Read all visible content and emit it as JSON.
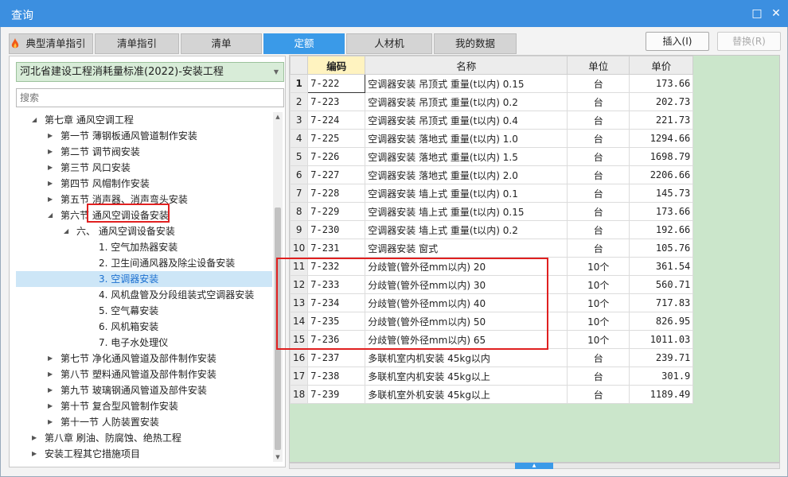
{
  "window": {
    "title": "查询",
    "minimize_glyph": "□",
    "close_glyph": "✕"
  },
  "tabs": [
    {
      "label": "典型清单指引",
      "active": false,
      "icon": "fire-icon"
    },
    {
      "label": "清单指引",
      "active": false
    },
    {
      "label": "清单",
      "active": false
    },
    {
      "label": "定额",
      "active": true
    },
    {
      "label": "人材机",
      "active": false
    },
    {
      "label": "我的数据",
      "active": false
    }
  ],
  "actions": {
    "insert_label": "插入(I)",
    "replace_label": "替换(R)"
  },
  "left": {
    "select_value": "河北省建设工程消耗量标准(2022)-安装工程",
    "search_placeholder": "搜索",
    "tree": [
      {
        "label": "第七章 通风空调工程",
        "level": 0,
        "expanded": true
      },
      {
        "label": "第一节 薄钢板通风管道制作安装",
        "level": 1,
        "expanded": false
      },
      {
        "label": "第二节 调节阀安装",
        "level": 1,
        "expanded": false
      },
      {
        "label": "第三节 风口安装",
        "level": 1,
        "expanded": false
      },
      {
        "label": "第四节 风帽制作安装",
        "level": 1,
        "expanded": false
      },
      {
        "label": "第五节 消声器、消声弯头安装",
        "level": 1,
        "expanded": false
      },
      {
        "label": "第六节 通风空调设备安装",
        "level": 1,
        "expanded": true
      },
      {
        "label": "六、 通风空调设备安装",
        "level": 2,
        "expanded": true
      },
      {
        "label": "1. 空气加热器安装",
        "level": 3
      },
      {
        "label": "2. 卫生间通风器及除尘设备安装",
        "level": 3
      },
      {
        "label": "3. 空调器安装",
        "level": 3,
        "selected": true
      },
      {
        "label": "4. 风机盘管及分段组装式空调器安装",
        "level": 3
      },
      {
        "label": "5. 空气幕安装",
        "level": 3
      },
      {
        "label": "6. 风机箱安装",
        "level": 3
      },
      {
        "label": "7. 电子水处理仪",
        "level": 3
      },
      {
        "label": "第七节 净化通风管道及部件制作安装",
        "level": 1,
        "expanded": false
      },
      {
        "label": "第八节 塑料通风管道及部件制作安装",
        "level": 1,
        "expanded": false
      },
      {
        "label": "第九节 玻璃钢通风管道及部件安装",
        "level": 1,
        "expanded": false
      },
      {
        "label": "第十节 复合型风管制作安装",
        "level": 1,
        "expanded": false
      },
      {
        "label": "第十一节 人防装置安装",
        "level": 1,
        "expanded": false
      },
      {
        "label": "第八章 刷油、防腐蚀、绝热工程",
        "level": 0,
        "expanded": false
      },
      {
        "label": "安装工程其它措施项目",
        "level": 0,
        "expanded": false
      }
    ]
  },
  "grid": {
    "columns": [
      "",
      "编码",
      "名称",
      "单位",
      "单价"
    ],
    "rows": [
      [
        "1",
        "7-222",
        "空调器安装 吊顶式 重量(t以内) 0.15",
        "台",
        "173.66"
      ],
      [
        "2",
        "7-223",
        "空调器安装 吊顶式 重量(t以内) 0.2",
        "台",
        "202.73"
      ],
      [
        "3",
        "7-224",
        "空调器安装 吊顶式 重量(t以内) 0.4",
        "台",
        "221.73"
      ],
      [
        "4",
        "7-225",
        "空调器安装 落地式 重量(t以内) 1.0",
        "台",
        "1294.66"
      ],
      [
        "5",
        "7-226",
        "空调器安装 落地式 重量(t以内) 1.5",
        "台",
        "1698.79"
      ],
      [
        "6",
        "7-227",
        "空调器安装 落地式 重量(t以内) 2.0",
        "台",
        "2206.66"
      ],
      [
        "7",
        "7-228",
        "空调器安装 墙上式 重量(t以内) 0.1",
        "台",
        "145.73"
      ],
      [
        "8",
        "7-229",
        "空调器安装 墙上式 重量(t以内) 0.15",
        "台",
        "173.66"
      ],
      [
        "9",
        "7-230",
        "空调器安装 墙上式 重量(t以内) 0.2",
        "台",
        "192.66"
      ],
      [
        "10",
        "7-231",
        "空调器安装 窗式",
        "台",
        "105.76"
      ],
      [
        "11",
        "7-232",
        "分歧管(管外径mm以内) 20",
        "10个",
        "361.54"
      ],
      [
        "12",
        "7-233",
        "分歧管(管外径mm以内) 30",
        "10个",
        "560.71"
      ],
      [
        "13",
        "7-234",
        "分歧管(管外径mm以内) 40",
        "10个",
        "717.83"
      ],
      [
        "14",
        "7-235",
        "分歧管(管外径mm以内) 50",
        "10个",
        "826.95"
      ],
      [
        "15",
        "7-236",
        "分歧管(管外径mm以内) 65",
        "10个",
        "1011.03"
      ],
      [
        "16",
        "7-237",
        "多联机室内机安装 45kg以内",
        "台",
        "239.71"
      ],
      [
        "17",
        "7-238",
        "多联机室内机安装 45kg以上",
        "台",
        "301.9"
      ],
      [
        "18",
        "7-239",
        "多联机室外机安装 45kg以上",
        "台",
        "1189.49"
      ]
    ]
  },
  "colors": {
    "titlebar": "#3c8fe0",
    "active_tab": "#3a9ae8",
    "highlight": "#e02020",
    "grid_bg": "#cbe6cb"
  }
}
